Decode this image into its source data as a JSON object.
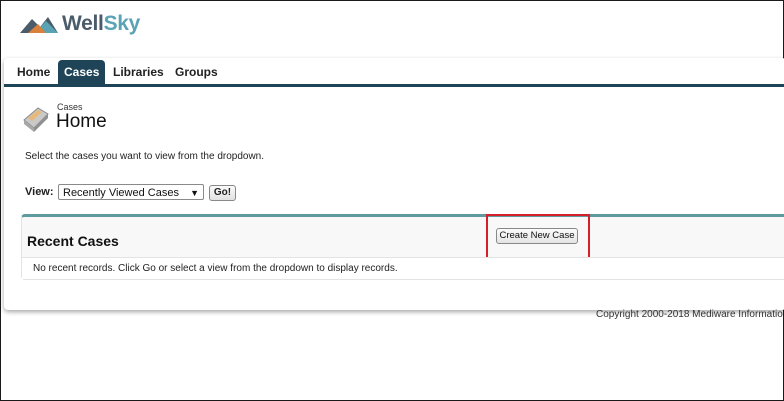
{
  "brand": {
    "name_part1": "Well",
    "name_part2": "Sky",
    "colors": {
      "dark": "#4a5c6a",
      "accent": "#59a3b4"
    }
  },
  "nav": {
    "tabs": [
      {
        "label": "Home",
        "active": false
      },
      {
        "label": "Cases",
        "active": true
      },
      {
        "label": "Libraries",
        "active": false
      },
      {
        "label": "Groups",
        "active": false
      }
    ],
    "active_color": "#1f4458"
  },
  "header": {
    "breadcrumb": "Cases",
    "title": "Home",
    "icon": "cases-icon"
  },
  "instructions": "Select the cases you want to view from the dropdown.",
  "view": {
    "label": "View:",
    "selected": "Recently Viewed Cases",
    "go_label": "Go!"
  },
  "recent": {
    "title": "Recent Cases",
    "create_label": "Create New Case",
    "empty_message": "No recent records. Click Go or select a view from the dropdown to display records."
  },
  "footer": {
    "copyright": "Copyright 2000-2018 Mediware Informatio"
  }
}
